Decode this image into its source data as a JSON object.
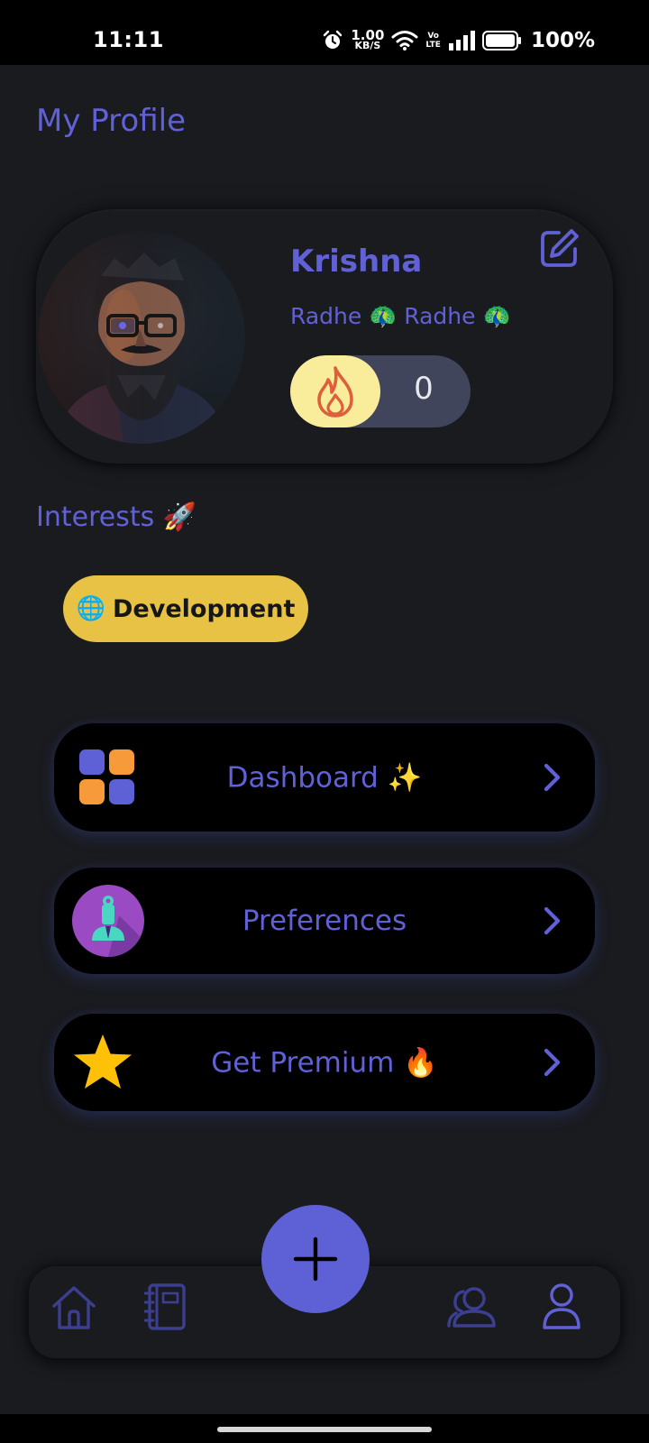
{
  "status_bar": {
    "time": "11:11",
    "speed_value": "1.00",
    "speed_unit": "KB/S",
    "network_label_top": "Vo",
    "network_label_bottom": "LTE",
    "battery": "100%",
    "icons": [
      "alarm-icon",
      "wifi-icon",
      "signal-icon",
      "battery-icon"
    ]
  },
  "header": {
    "title": "My Profile"
  },
  "profile": {
    "name": "Krishna",
    "bio": "Radhe 🦚 Radhe 🦚",
    "streak_count": "0",
    "icons": [
      "avatar",
      "edit-icon",
      "fire-icon"
    ]
  },
  "interests": {
    "title": "Interests 🚀",
    "chips": [
      {
        "emoji": "🌐",
        "label": "Development"
      }
    ]
  },
  "menu": {
    "items": [
      {
        "label": "Dashboard ✨",
        "icon": "grid-icon"
      },
      {
        "label": "Preferences",
        "icon": "preferences-icon"
      },
      {
        "label": "Get Premium 🔥",
        "icon": "star-icon"
      }
    ]
  },
  "bottom_nav": {
    "items": [
      "home-icon",
      "notebook-icon",
      "community-icon",
      "profile-icon"
    ],
    "fab_icon": "plus-icon"
  },
  "colors": {
    "accent": "#6061d6",
    "background": "#1a1b1f",
    "chip": "#e8c245",
    "streak_fire_bg": "#f9ed9b",
    "star": "#ffc107"
  }
}
